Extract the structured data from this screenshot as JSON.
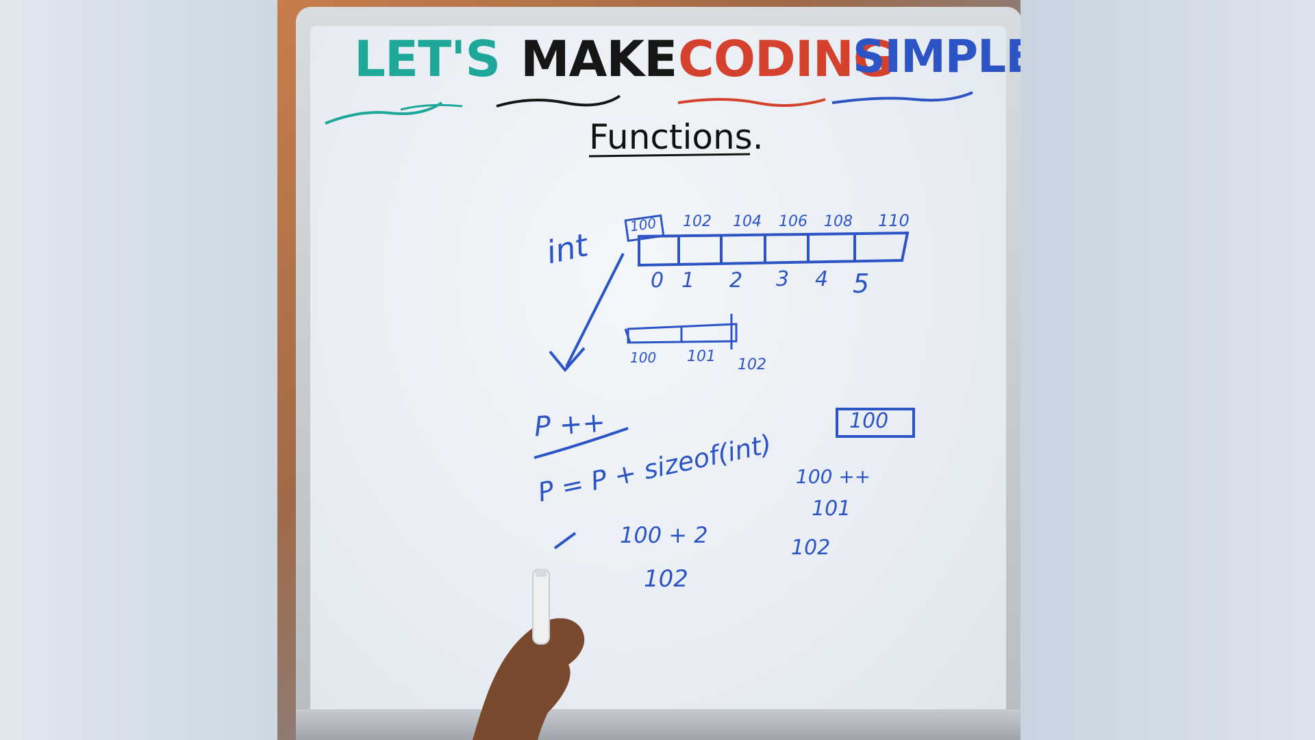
{
  "title": {
    "w1": "LET'S",
    "w2": "MAKE",
    "w3": "CODING",
    "w4": "SIMPLE"
  },
  "topic": "Functions.",
  "colors": {
    "teal": "#1fa79a",
    "black": "#161616",
    "red": "#d4412c",
    "blue": "#2c54c4"
  },
  "board": {
    "type_label": "int",
    "addresses": [
      "100",
      "102",
      "104",
      "106",
      "108",
      "110"
    ],
    "indices": [
      "0",
      "1",
      "2",
      "3",
      "4",
      "5"
    ],
    "byte_addresses": [
      "100",
      "101",
      "102"
    ],
    "pointer_value": "100",
    "increment": "P ++",
    "formula": "P = P + sizeof(int)",
    "calc_line": "100 + 2",
    "calc_result": "102",
    "alt_increment": "100 ++",
    "alt_step1": "101",
    "alt_step2": "102"
  }
}
